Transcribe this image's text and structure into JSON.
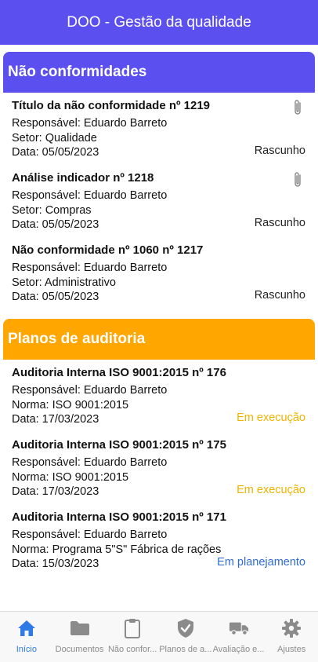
{
  "header": {
    "title": "DOO - Gestão da qualidade"
  },
  "colors": {
    "primary": "#5b4ff0",
    "orange": "#ffa600",
    "active_tab": "#2f7be6",
    "status_exec": "#f0b400",
    "status_plan": "#2f6bd3"
  },
  "non_conformities": {
    "title": "Não conformidades",
    "items": [
      {
        "title": "Título da não conformidade nº 1219",
        "responsible": "Responsável: Eduardo Barreto",
        "sector": "Setor: Qualidade",
        "date": "Data: 05/05/2023",
        "status": "Rascunho",
        "has_attachment": true
      },
      {
        "title": "Análise indicador nº 1218",
        "responsible": "Responsável: Eduardo Barreto",
        "sector": "Setor: Compras",
        "date": "Data: 05/05/2023",
        "status": "Rascunho",
        "has_attachment": true
      },
      {
        "title": "Não conformidade nº 1060 nº 1217",
        "responsible": "Responsável: Eduardo Barreto",
        "sector": "Setor: Administrativo",
        "date": "Data: 05/05/2023",
        "status": "Rascunho",
        "has_attachment": false
      }
    ]
  },
  "audit_plans": {
    "title": "Planos de auditoria",
    "items": [
      {
        "title": "Auditoria Interna ISO 9001:2015 nº 176",
        "responsible": "Responsável: Eduardo Barreto",
        "norm": "Norma: ISO 9001:2015",
        "date": "Data: 17/03/2023",
        "status": "Em execução"
      },
      {
        "title": "Auditoria Interna ISO 9001:2015 nº 175",
        "responsible": "Responsável: Eduardo Barreto",
        "norm": "Norma: ISO 9001:2015",
        "date": "Data: 17/03/2023",
        "status": "Em execução"
      },
      {
        "title": "Auditoria Interna ISO 9001:2015 nº 171",
        "responsible": "Responsável: Eduardo Barreto",
        "norm": "Norma: Programa 5\"S\" Fábrica de rações",
        "date": "Data: 15/03/2023",
        "status": "Em planejamento"
      }
    ]
  },
  "tabbar": {
    "tabs": [
      {
        "label": "Início",
        "icon": "home-icon",
        "active": true
      },
      {
        "label": "Documentos",
        "icon": "folder-icon",
        "active": false
      },
      {
        "label": "Não confor...",
        "icon": "clipboard-icon",
        "active": false
      },
      {
        "label": "Planos de a...",
        "icon": "shield-check-icon",
        "active": false
      },
      {
        "label": "Avaliação e...",
        "icon": "truck-icon",
        "active": false
      },
      {
        "label": "Ajustes",
        "icon": "gear-icon",
        "active": false
      }
    ]
  }
}
